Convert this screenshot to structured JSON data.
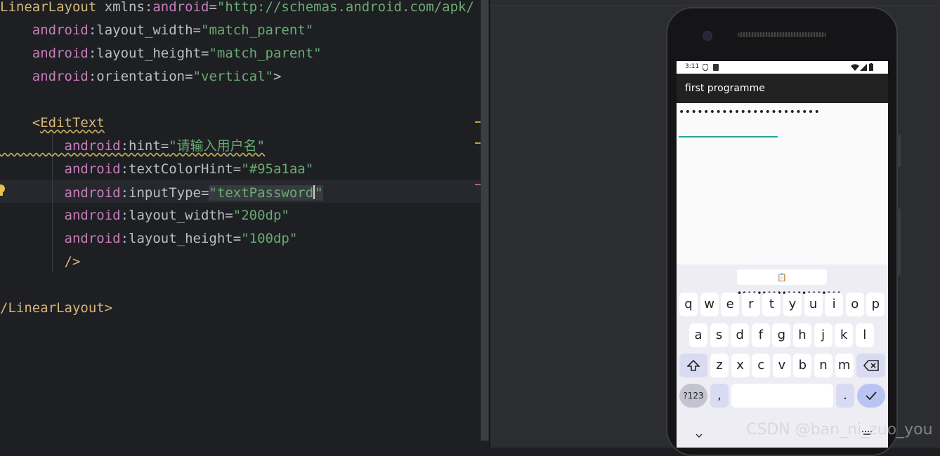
{
  "editor": {
    "lines": [
      {
        "segments": [
          {
            "t": "LinearLayout ",
            "c": "tag"
          },
          {
            "t": "xmlns:",
            "c": "plain"
          },
          {
            "t": "android",
            "c": "attr"
          },
          {
            "t": "=",
            "c": "plain"
          },
          {
            "t": "\"http://schemas.android.com/apk/",
            "c": "str"
          }
        ]
      },
      {
        "segments": [
          {
            "t": "    android",
            "c": "attr"
          },
          {
            "t": ":layout_width=",
            "c": "plain"
          },
          {
            "t": "\"match_parent\"",
            "c": "str"
          }
        ]
      },
      {
        "segments": [
          {
            "t": "    android",
            "c": "attr"
          },
          {
            "t": ":layout_height=",
            "c": "plain"
          },
          {
            "t": "\"match_parent\"",
            "c": "str"
          }
        ]
      },
      {
        "segments": [
          {
            "t": "    android",
            "c": "attr"
          },
          {
            "t": ":orientation=",
            "c": "plain"
          },
          {
            "t": "\"vertical\"",
            "c": "str"
          },
          {
            "t": ">",
            "c": "plain"
          }
        ]
      },
      {
        "segments": []
      },
      {
        "segments": [
          {
            "t": "    <",
            "c": "tag"
          },
          {
            "t": "EditText",
            "c": "tag wavy"
          }
        ]
      },
      {
        "segments": [
          {
            "t": "        android",
            "c": "attr wavy"
          },
          {
            "t": ":hint=",
            "c": "plain wavy"
          },
          {
            "t": "\"请输入用户名\"",
            "c": "str wavy"
          }
        ]
      },
      {
        "segments": [
          {
            "t": "        android",
            "c": "attr"
          },
          {
            "t": ":textColorHint=",
            "c": "plain"
          },
          {
            "t": "\"#95a1aa\"",
            "c": "str"
          }
        ]
      },
      {
        "segments": [
          {
            "t": "        android",
            "c": "attr"
          },
          {
            "t": ":inputType=",
            "c": "plain"
          },
          {
            "t": "\"textPassword",
            "c": "str hl"
          },
          {
            "t": "CARET",
            "c": "caret"
          },
          {
            "t": "\"",
            "c": "str hl"
          }
        ]
      },
      {
        "segments": [
          {
            "t": "        android",
            "c": "attr"
          },
          {
            "t": ":layout_width=",
            "c": "plain"
          },
          {
            "t": "\"200dp\"",
            "c": "str"
          }
        ]
      },
      {
        "segments": [
          {
            "t": "        android",
            "c": "attr"
          },
          {
            "t": ":layout_height=",
            "c": "plain"
          },
          {
            "t": "\"100dp\"",
            "c": "str"
          }
        ]
      },
      {
        "segments": [
          {
            "t": "        />",
            "c": "tag"
          }
        ]
      },
      {
        "segments": []
      },
      {
        "segments": [
          {
            "t": "/LinearLayout>",
            "c": "tag"
          }
        ]
      }
    ]
  },
  "phone": {
    "status_time": "3:11",
    "app_title": "first programme",
    "password_dots": "•••••••••••••••••••••••",
    "suggestion": "•••••••••••••••••••••",
    "keys_row1": [
      "q",
      "w",
      "e",
      "r",
      "t",
      "y",
      "u",
      "i",
      "o",
      "p"
    ],
    "keys_row2": [
      "a",
      "s",
      "d",
      "f",
      "g",
      "h",
      "j",
      "k",
      "l"
    ],
    "keys_row3": [
      "z",
      "x",
      "c",
      "v",
      "b",
      "n",
      "m"
    ],
    "symbols_key": "?123",
    "comma_key": ",",
    "period_key": ".",
    "shift_icon": "shift-icon",
    "backspace_icon": "backspace-icon",
    "enter_icon": "check-icon"
  },
  "watermark": "CSDN @ban_ni_zuo_you",
  "colors": {
    "accent_underline": "#26a69a",
    "string": "#6aab73",
    "attribute": "#c77dbb",
    "tag": "#d5b778"
  }
}
